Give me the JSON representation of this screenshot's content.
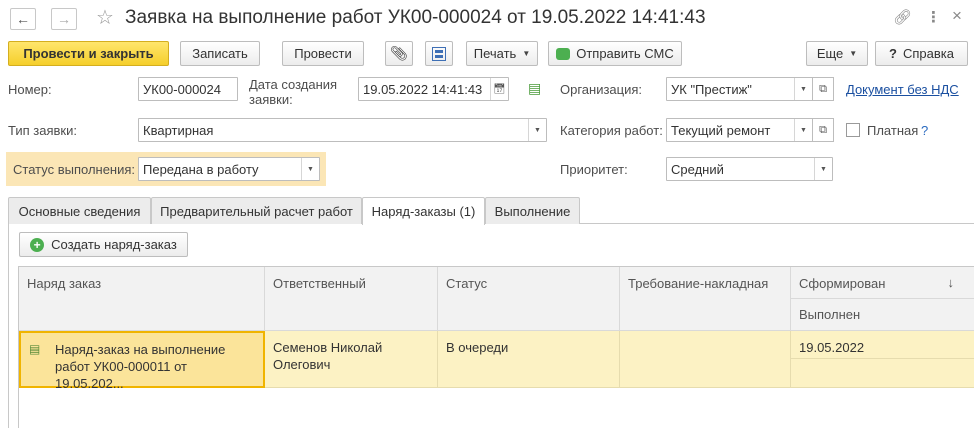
{
  "window": {
    "title": "Заявка на выполнение работ УК00-000024 от 19.05.2022 14:41:43",
    "back_icon": "arrow-left-icon",
    "forward_icon": "arrow-right-icon",
    "favorite_icon": "star-icon",
    "link_icon": "link-icon",
    "more_icon": "more-vertical-icon",
    "close_icon": "close-icon"
  },
  "toolbar": {
    "post_close": "Провести и закрыть",
    "save": "Записать",
    "post": "Провести",
    "print": "Печать",
    "send_sms": "Отправить СМС",
    "more": "Еще",
    "help": "Справка"
  },
  "form": {
    "number_label": "Номер:",
    "number_value": "УК00-000024",
    "created_label_line1": "Дата создания",
    "created_label_line2": "заявки:",
    "created_value": "19.05.2022 14:41:43",
    "org_label": "Организация:",
    "org_value": "УК \"Престиж\"",
    "doc_link": "Документ без НДС",
    "type_label": "Тип заявки:",
    "type_value": "Квартирная",
    "category_label": "Категория работ:",
    "category_value": "Текущий ремонт",
    "paid_label": "Платная",
    "paid_help": "?",
    "status_label": "Статус выполнения:",
    "status_value": "Передана в работу",
    "priority_label": "Приоритет:",
    "priority_value": "Средний"
  },
  "tabs": [
    {
      "label": "Основные сведения"
    },
    {
      "label": "Предварительный расчет работ"
    },
    {
      "label": "Наряд-заказы (1)"
    },
    {
      "label": "Выполнение"
    }
  ],
  "orders": {
    "create_button": "Создать наряд-заказ",
    "columns": {
      "order": "Наряд заказ",
      "responsible": "Ответственный",
      "status": "Статус",
      "requirement": "Требование-накладная",
      "formed": "Сформирован",
      "sort_arrow": "↓",
      "done": "Выполнен"
    },
    "rows": [
      {
        "order_line1": "Наряд-заказ на выполнение",
        "order_line2": "работ УК00-000011 от 19.05.202...",
        "responsible_line1": "Семенов Николай",
        "responsible_line2": "Олегович",
        "status": "В очереди",
        "requirement": "",
        "formed": "19.05.2022",
        "done": ""
      }
    ]
  },
  "colors": {
    "primary_button": "#f5cf2b",
    "status_highlight": "#fbe6b6",
    "selected_row": "#fcf2c4",
    "link": "#1a4fa0"
  }
}
